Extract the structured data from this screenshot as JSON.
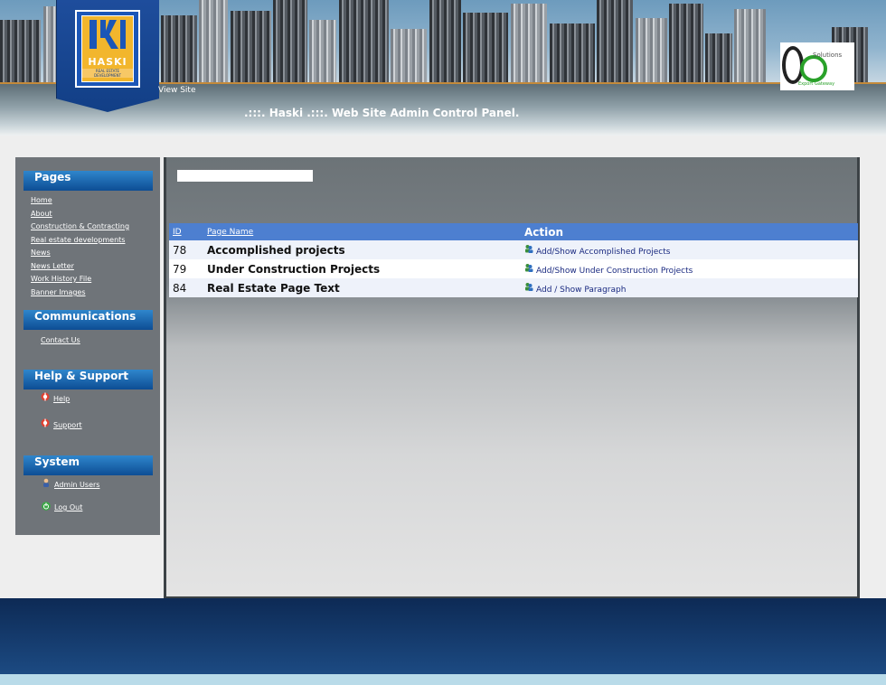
{
  "header": {
    "logo_text": "HASKI",
    "logo_tagline": "REAL ESTATE DEVELOPMENT",
    "view_site_label": "View Site",
    "panel_title": ".:::. Haski .:::. Web Site Admin Control Panel.",
    "partner_logo_text": "Solutions",
    "partner_logo_sub": "Export Gateway"
  },
  "sidebar": {
    "sections": [
      {
        "title": "Pages",
        "items": [
          "Home",
          "About ",
          "Construction & Contracting ",
          "Real estate developments ",
          "News ",
          "News Letter",
          "Work History File",
          "Banner Images"
        ]
      },
      {
        "title": "Communications",
        "items": [
          "Contact Us "
        ]
      },
      {
        "title": "Help & Support",
        "items": [
          "Help",
          "Support"
        ]
      },
      {
        "title": "System",
        "items": [
          "Admin Users",
          "Log Out"
        ]
      }
    ]
  },
  "main": {
    "search_value": "",
    "table": {
      "columns": [
        "ID",
        "Page Name",
        "Action"
      ],
      "rows": [
        {
          "id": "78",
          "name": "Accomplished projects",
          "action": "Add/Show Accomplished Projects"
        },
        {
          "id": "79",
          "name": "Under Construction Projects",
          "action": "Add/Show Under Construction Projects"
        },
        {
          "id": "84",
          "name": "Real Estate Page Text",
          "action": "Add / Show Paragraph"
        }
      ]
    }
  },
  "colors": {
    "accent_blue": "#4d7fd0",
    "sidebar_bg": "#6f7479",
    "footer_navy": "#0d2a55"
  },
  "icons": {
    "help": "lifebuoy-icon",
    "support": "lifebuoy-icon",
    "admin_users": "user-icon",
    "log_out": "power-icon",
    "action": "edit-users-icon"
  }
}
